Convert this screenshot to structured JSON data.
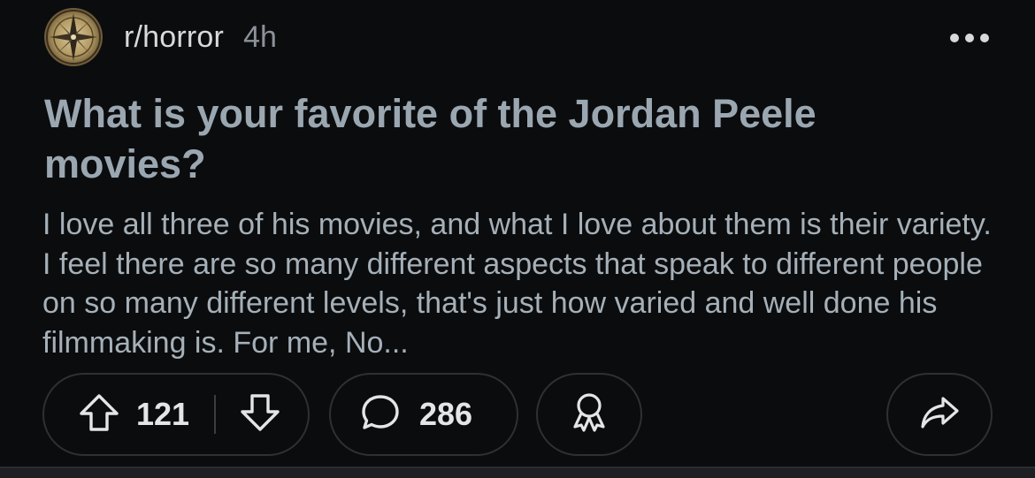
{
  "post": {
    "subreddit": "r/horror",
    "age": "4h",
    "title": "What is your favorite of the Jordan Peele movies?",
    "body": "I love all three of his movies, and what I love about them is their variety. I feel there are so many different aspects that speak to different people on so many different levels, that's just how varied and well done his filmmaking is. For me, No...",
    "upvotes": "121",
    "comments": "286"
  },
  "icons": {
    "avatar": "subreddit-avatar-compass",
    "more": "more-options-icon",
    "upvote": "upvote-arrow-icon",
    "downvote": "downvote-arrow-icon",
    "comment": "comment-bubble-icon",
    "award": "award-ribbon-icon",
    "share": "share-arrow-icon"
  },
  "colors": {
    "background": "#0b0c0e",
    "title": "#9aa7b1",
    "body": "#a5b0b8",
    "muted": "#8c9298",
    "pill_border": "#2e3134"
  }
}
